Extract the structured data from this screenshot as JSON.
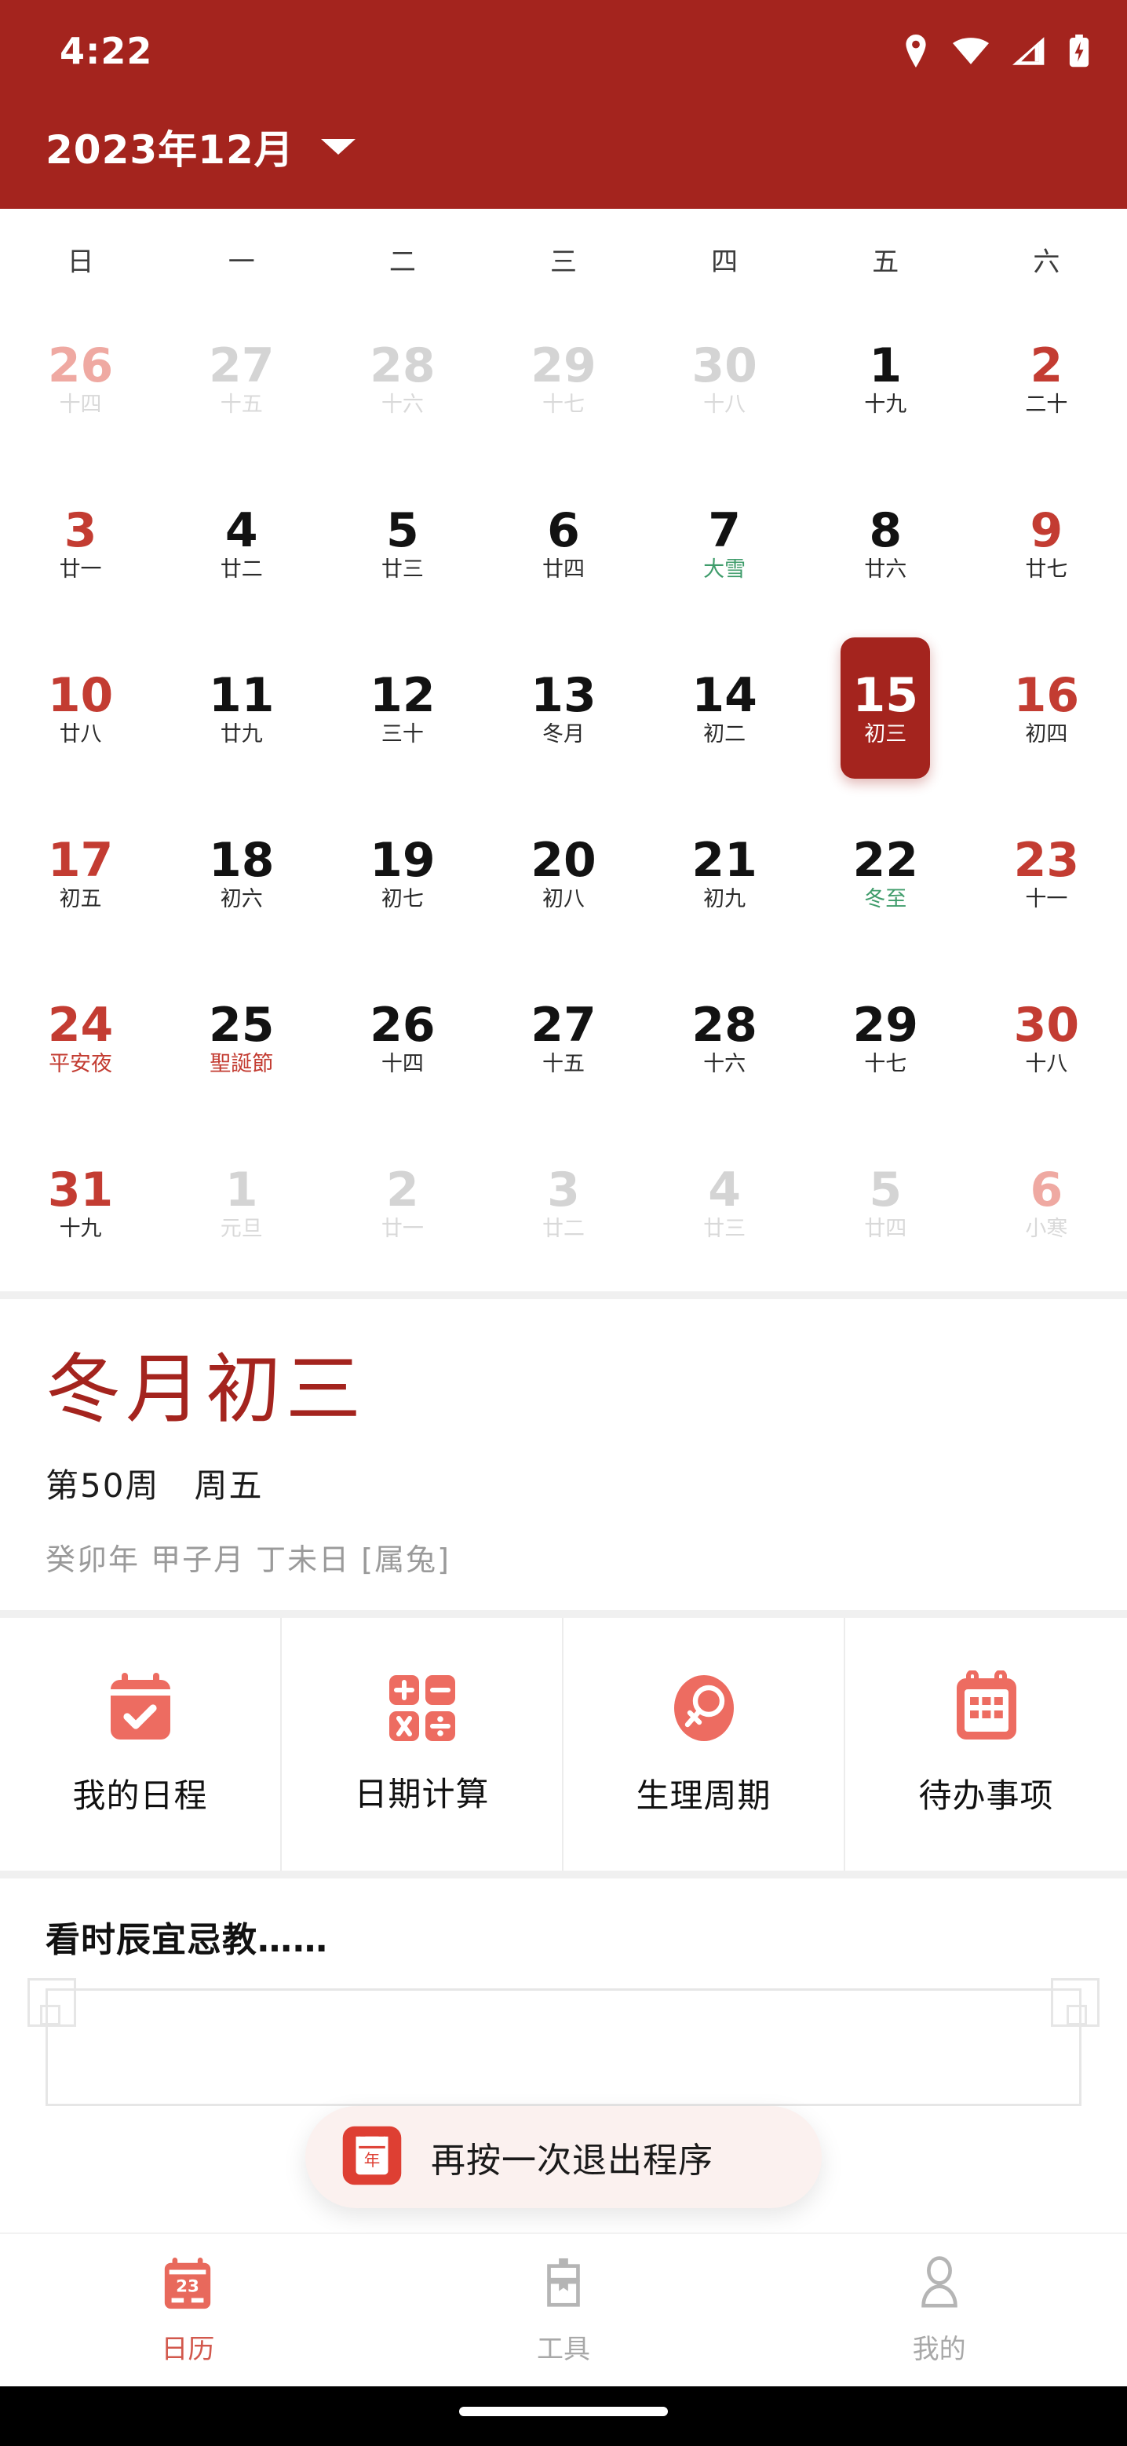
{
  "statusbar": {
    "time": "4:22",
    "icons": [
      "location-icon",
      "wifi-icon",
      "signal-icon",
      "battery-charging-icon"
    ]
  },
  "appbar": {
    "title": "2023年12月",
    "dropdown_icon": "chevron-down-icon"
  },
  "calendar": {
    "weekdays": [
      "日",
      "一",
      "二",
      "三",
      "四",
      "五",
      "六"
    ],
    "selected_day": "15",
    "days": [
      {
        "num": "26",
        "lunar": "十四",
        "style": "c-mutered"
      },
      {
        "num": "27",
        "lunar": "十五",
        "style": "c-mute"
      },
      {
        "num": "28",
        "lunar": "十六",
        "style": "c-mute"
      },
      {
        "num": "29",
        "lunar": "十七",
        "style": "c-mute"
      },
      {
        "num": "30",
        "lunar": "十八",
        "style": "c-mute"
      },
      {
        "num": "1",
        "lunar": "十九",
        "style": ""
      },
      {
        "num": "2",
        "lunar": "二十",
        "style": "c-red"
      },
      {
        "num": "3",
        "lunar": "廿一",
        "style": "c-red"
      },
      {
        "num": "4",
        "lunar": "廿二",
        "style": ""
      },
      {
        "num": "5",
        "lunar": "廿三",
        "style": ""
      },
      {
        "num": "6",
        "lunar": "廿四",
        "style": ""
      },
      {
        "num": "7",
        "lunar": "大雪",
        "style": "",
        "lunar_kind": "term"
      },
      {
        "num": "8",
        "lunar": "廿六",
        "style": ""
      },
      {
        "num": "9",
        "lunar": "廿七",
        "style": "c-red"
      },
      {
        "num": "10",
        "lunar": "廿八",
        "style": "c-red"
      },
      {
        "num": "11",
        "lunar": "廿九",
        "style": ""
      },
      {
        "num": "12",
        "lunar": "三十",
        "style": ""
      },
      {
        "num": "13",
        "lunar": "冬月",
        "style": ""
      },
      {
        "num": "14",
        "lunar": "初二",
        "style": ""
      },
      {
        "num": "15",
        "lunar": "初三",
        "style": "sel"
      },
      {
        "num": "16",
        "lunar": "初四",
        "style": "c-red"
      },
      {
        "num": "17",
        "lunar": "初五",
        "style": "c-red"
      },
      {
        "num": "18",
        "lunar": "初六",
        "style": ""
      },
      {
        "num": "19",
        "lunar": "初七",
        "style": ""
      },
      {
        "num": "20",
        "lunar": "初八",
        "style": ""
      },
      {
        "num": "21",
        "lunar": "初九",
        "style": ""
      },
      {
        "num": "22",
        "lunar": "冬至",
        "style": "",
        "lunar_kind": "term"
      },
      {
        "num": "23",
        "lunar": "十一",
        "style": "c-red"
      },
      {
        "num": "24",
        "lunar": "平安夜",
        "style": "c-red",
        "lunar_kind": "fest"
      },
      {
        "num": "25",
        "lunar": "聖誕節",
        "style": "",
        "lunar_kind": "fest"
      },
      {
        "num": "26",
        "lunar": "十四",
        "style": ""
      },
      {
        "num": "27",
        "lunar": "十五",
        "style": ""
      },
      {
        "num": "28",
        "lunar": "十六",
        "style": ""
      },
      {
        "num": "29",
        "lunar": "十七",
        "style": ""
      },
      {
        "num": "30",
        "lunar": "十八",
        "style": "c-red"
      },
      {
        "num": "31",
        "lunar": "十九",
        "style": "c-red"
      },
      {
        "num": "1",
        "lunar": "元旦",
        "style": "c-mute"
      },
      {
        "num": "2",
        "lunar": "廿一",
        "style": "c-mute"
      },
      {
        "num": "3",
        "lunar": "廿二",
        "style": "c-mute"
      },
      {
        "num": "4",
        "lunar": "廿三",
        "style": "c-mute"
      },
      {
        "num": "5",
        "lunar": "廿四",
        "style": "c-mute"
      },
      {
        "num": "6",
        "lunar": "小寒",
        "style": "c-mutered"
      }
    ]
  },
  "detail": {
    "lunar_date": "冬月初三",
    "week_line": "第50周　周五",
    "ganzhi": "癸卯年 甲子月 丁未日 [属兔]"
  },
  "tiles": [
    {
      "label": "我的日程",
      "icon": "calendar-check-icon"
    },
    {
      "label": "日期计算",
      "icon": "calculator-icon"
    },
    {
      "label": "生理周期",
      "icon": "female-symbol-icon"
    },
    {
      "label": "待办事项",
      "icon": "calendar-grid-icon"
    }
  ],
  "bottom_section": {
    "heading": "看时辰宜忌教……"
  },
  "toast": {
    "icon": "app-calendar-icon",
    "icon_text": "年",
    "message": "再按一次退出程序"
  },
  "navbar": {
    "items": [
      {
        "label": "日历",
        "icon": "calendar-tab-icon",
        "badge": "23",
        "active": true
      },
      {
        "label": "工具",
        "icon": "toolbox-tab-icon",
        "active": false
      },
      {
        "label": "我的",
        "icon": "person-tab-icon",
        "active": false
      }
    ]
  },
  "colors": {
    "brand_red": "#A4241E",
    "accent_red": "#C33C32",
    "tile_red": "#ED6C61",
    "term_green": "#3F9C6B",
    "toast_bg": "#FBF1EF"
  }
}
